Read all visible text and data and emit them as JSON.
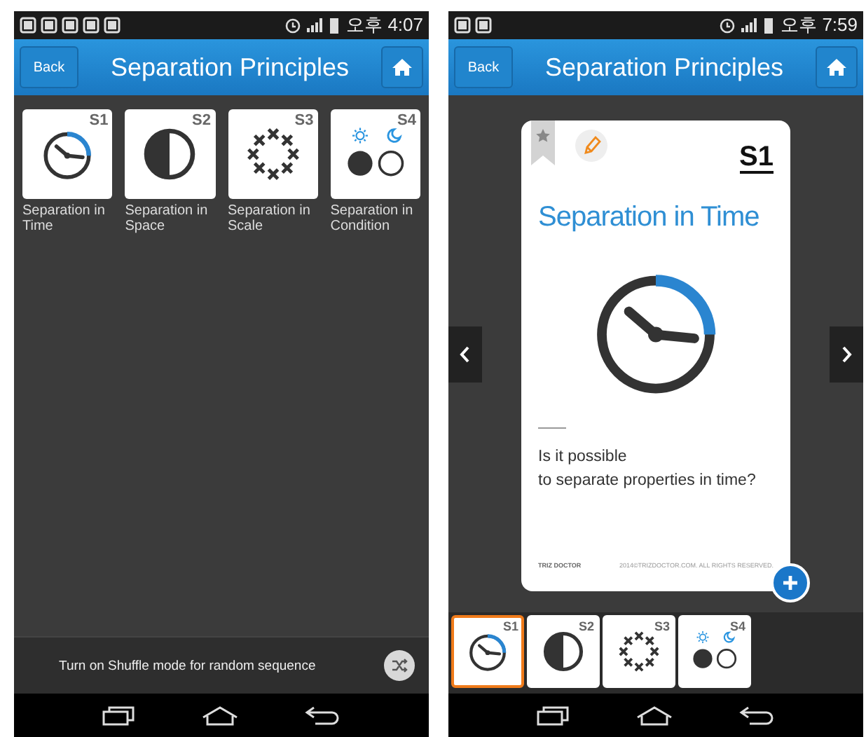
{
  "screens": [
    {
      "status_bar": {
        "time": "오후 4:07"
      },
      "header": {
        "back": "Back",
        "title": "Separation Principles"
      },
      "principles": [
        {
          "code": "S1",
          "label": "Separation in Time",
          "kind": "time"
        },
        {
          "code": "S2",
          "label": "Separation in Space",
          "kind": "space"
        },
        {
          "code": "S3",
          "label": "Separation in Scale",
          "kind": "scale"
        },
        {
          "code": "S4",
          "label": "Separation in Condition",
          "kind": "condition"
        }
      ],
      "shuffle_bar": {
        "text": "Turn on Shuffle mode for random sequence"
      }
    },
    {
      "status_bar": {
        "time": "오후 7:59"
      },
      "header": {
        "back": "Back",
        "title": "Separation Principles"
      },
      "card": {
        "code": "S1",
        "title": "Separation in Time",
        "kind": "time",
        "question": "Is it possible\nto separate properties in time?",
        "brand": "TRIZ DOCTOR",
        "copyright": "2014©TRIZDOCTOR.COM. ALL RIGHTS RESERVED."
      },
      "thumbnails": [
        {
          "code": "S1",
          "kind": "time",
          "selected": true
        },
        {
          "code": "S2",
          "kind": "space",
          "selected": false
        },
        {
          "code": "S3",
          "kind": "scale",
          "selected": false
        },
        {
          "code": "S4",
          "kind": "condition",
          "selected": false
        }
      ]
    }
  ]
}
